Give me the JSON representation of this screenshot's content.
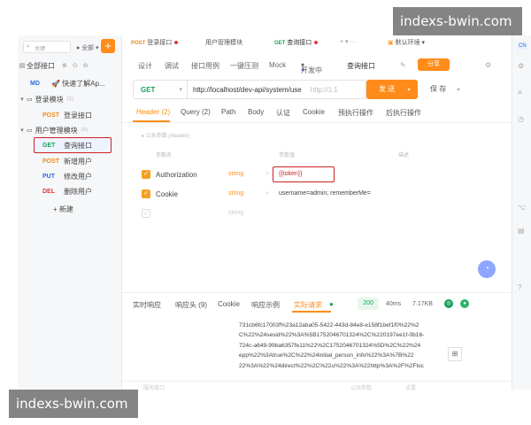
{
  "watermark": "indexs-bwin.com",
  "sidebar": {
    "search_placeholder": "关键",
    "scope": "全部",
    "add_label": "+",
    "all_label": "全部接口",
    "quick_item": {
      "method": "MD",
      "label": "🚀 快速了解Ap..."
    },
    "groups": [
      {
        "label": "登录模块",
        "count": "(1)"
      },
      {
        "label": "用户管理模块",
        "count": "(4)"
      }
    ],
    "login_items": [
      {
        "method": "POST",
        "label": "登录接口"
      }
    ],
    "user_items": [
      {
        "method": "GET",
        "label": "查询接口"
      },
      {
        "method": "POST",
        "label": "新增用户"
      },
      {
        "method": "PUT",
        "label": "修改用户"
      },
      {
        "method": "DEL",
        "label": "删除用户"
      }
    ],
    "new_label": "+ 新建"
  },
  "tabs": {
    "tab1": {
      "method": "POST",
      "label": "登录接口"
    },
    "tab2": {
      "label": "用户管理模块"
    },
    "tab3": {
      "method": "GET",
      "label": "查询接口"
    },
    "plus": "+",
    "env": "默认环境"
  },
  "subbar": {
    "items": [
      "设计",
      "调试",
      "接口用例",
      "一键压测",
      "Mock"
    ],
    "dev_status": "开发中",
    "name": "查询接口",
    "share": "分享"
  },
  "request": {
    "method": "GET",
    "url": "http://localhost/dev-api/system/use",
    "url_suffix": "http://1.1",
    "send": "发 送",
    "save": "保 存"
  },
  "param_tabs": [
    "Header (2)",
    "Query (2)",
    "Path",
    "Body",
    "认证",
    "Cookie",
    "预执行操作",
    "后执行操作"
  ],
  "public_params": "公共参数 (Header)",
  "header_table": {
    "col_name": "参数名",
    "col_value": "参数值",
    "col_desc": "描述",
    "rows": [
      {
        "name": "Authorization",
        "type": "string",
        "value": "{{token}}"
      },
      {
        "name": "Cookie",
        "type": "string",
        "value": "username=admin; rememberMe="
      },
      {
        "name": "",
        "type": "string",
        "value": ""
      }
    ]
  },
  "response": {
    "tabs": [
      "实时响应",
      "响应头 (9)",
      "Cookie",
      "响应示例",
      "实际请求"
    ],
    "status": "200",
    "time": "40ms",
    "size": "7.17KB",
    "lines": [
      "731cb6fc17003f%23a12aba05-5422-443d-84e8-e158f1bef1f0%22%2",
      "C%22%24sesid%22%3A%5B1752046701324%2C%220197ee1f-0b16-",
      "724c-a649-99ba6357fe11%22%2C1752046701324%5D%2C%22%24",
      "epp%22%3Atrue%2C%22%24initial_person_info%22%3A%7B%22",
      "22%3A%22%24direct%22%2C%22u%22%3A%22http%3A%2F%2Floc"
    ]
  },
  "bottombar": {
    "left": "服务接口",
    "mid": "公共参数",
    "right": "设置"
  },
  "rail": {
    "cn": "CN"
  }
}
